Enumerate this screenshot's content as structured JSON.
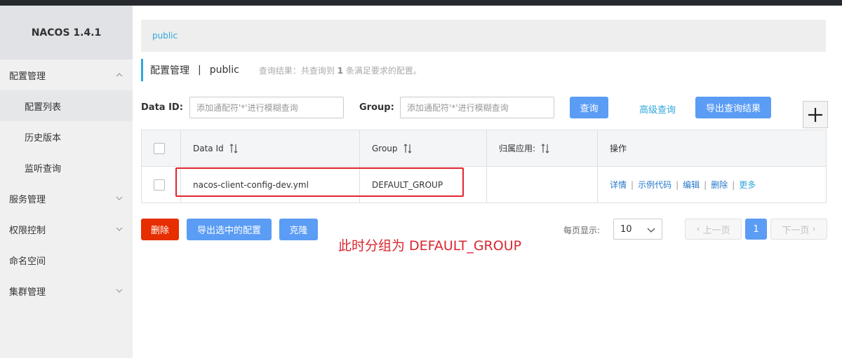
{
  "app": {
    "brand": "NACOS 1.4.1"
  },
  "sidebar": {
    "items": [
      {
        "label": "配置管理",
        "expanded": true
      },
      {
        "label": "配置列表",
        "sub": true,
        "active": true
      },
      {
        "label": "历史版本",
        "sub": true
      },
      {
        "label": "监听查询",
        "sub": true
      },
      {
        "label": "服务管理",
        "expanded": false
      },
      {
        "label": "权限控制",
        "expanded": false
      },
      {
        "label": "命名空间"
      },
      {
        "label": "集群管理",
        "expanded": false
      }
    ]
  },
  "namespace_bar": {
    "current": "public"
  },
  "header": {
    "title": "配置管理",
    "separator": "|",
    "namespace": "public",
    "result_prefix": "查询结果：共查询到",
    "result_count": "1",
    "result_suffix": "条满足要求的配置。"
  },
  "search": {
    "dataid_label": "Data ID:",
    "dataid_placeholder": "添加通配符'*'进行模糊查询",
    "group_label": "Group:",
    "group_placeholder": "添加通配符'*'进行模糊查询",
    "query_button": "查询",
    "advanced_link": "高级查询",
    "export_button": "导出查询结果",
    "plus_button": "+"
  },
  "table": {
    "columns": [
      "Data Id",
      "Group",
      "归属应用:",
      "操作"
    ],
    "rows": [
      {
        "data_id": "nacos-client-config-dev.yml",
        "group": "DEFAULT_GROUP",
        "app": "",
        "ops": [
          "详情",
          "示例代码",
          "编辑",
          "删除",
          "更多"
        ]
      }
    ]
  },
  "footer": {
    "delete_button": "删除",
    "export_selected_button": "导出选中的配置",
    "clone_button": "克隆",
    "page_size_label": "每页显示:",
    "page_size": "10",
    "prev_button": "上一页",
    "current_page": "1",
    "next_button": "下一页"
  },
  "annotation": {
    "text": "此时分组为 DEFAULT_GROUP"
  },
  "colors": {
    "accent": "#2fa7db",
    "primary_button": "#5b9cf5",
    "danger_button": "#e62e00",
    "annotation": "#d9262f"
  }
}
